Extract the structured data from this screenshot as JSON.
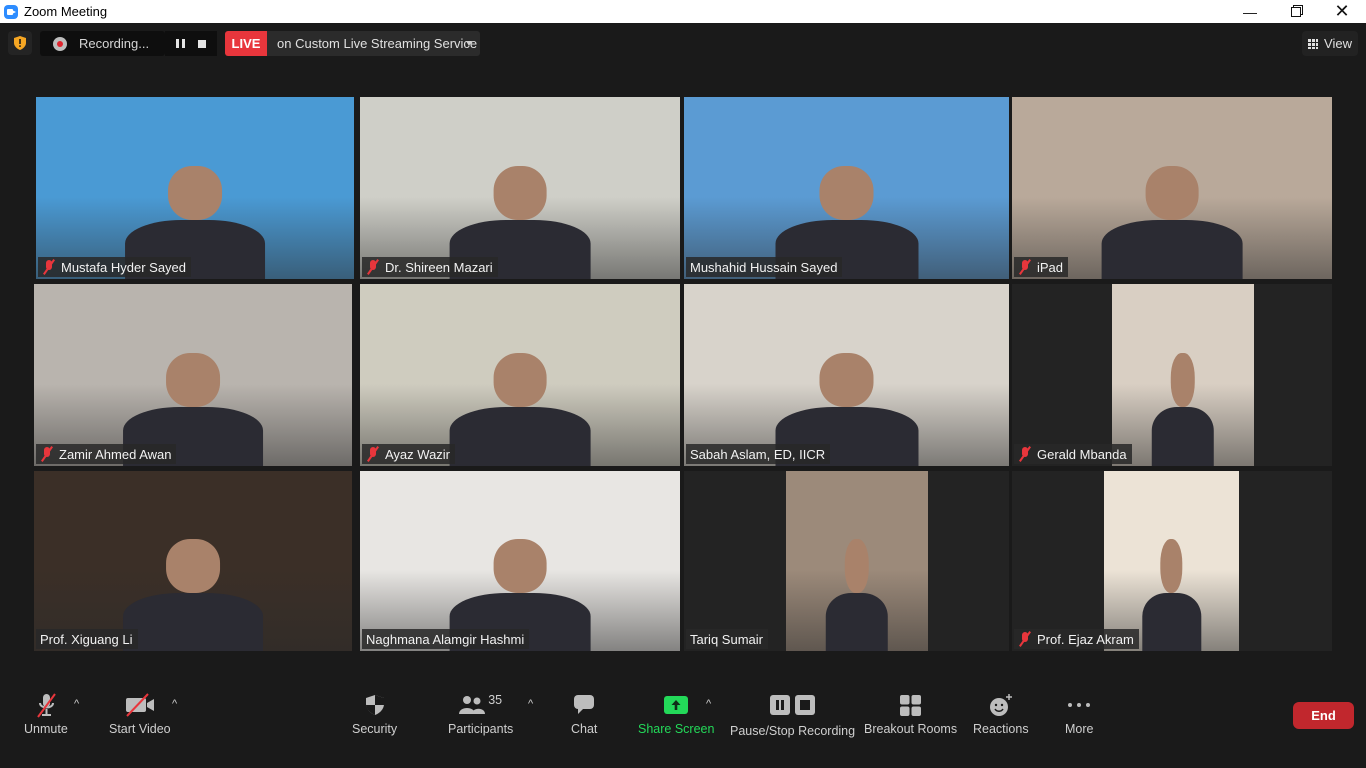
{
  "window": {
    "title": "Zoom Meeting",
    "controls": [
      "minimize",
      "restore",
      "close"
    ]
  },
  "topbar": {
    "security_icon": "shield-alert-icon",
    "recording_label": "Recording...",
    "live_badge": "LIVE",
    "live_service": "on Custom Live Streaming Service",
    "view_label": "View"
  },
  "participants_grid": [
    {
      "name": "Mustafa Hyder Sayed",
      "muted": true,
      "active": false,
      "bg": "#4a9ad4"
    },
    {
      "name": "Dr. Shireen Mazari",
      "muted": true,
      "active": false,
      "bg": "#cfcfc8"
    },
    {
      "name": "Mushahid Hussain Sayed",
      "muted": false,
      "active": false,
      "bg": "#5b9bd3"
    },
    {
      "name": "iPad",
      "muted": true,
      "active": false,
      "bg": "#b9a99a"
    },
    {
      "name": "Zamir Ahmed Awan",
      "muted": true,
      "active": false,
      "bg": "#b9b4ae"
    },
    {
      "name": "Ayaz Wazir",
      "muted": true,
      "active": false,
      "bg": "#cfccbf"
    },
    {
      "name": "Sabah Aslam, ED, IICR",
      "muted": false,
      "active": true,
      "bg": "#d8d3cb"
    },
    {
      "name": "Gerald Mbanda",
      "muted": true,
      "active": false,
      "bg": "#d9cfc3"
    },
    {
      "name": "Prof. Xiguang Li",
      "muted": false,
      "active": false,
      "bg": "#3b2f27"
    },
    {
      "name": "Naghmana Alamgir Hashmi",
      "muted": false,
      "active": false,
      "bg": "#e8e6e3"
    },
    {
      "name": "Tariq Sumair",
      "muted": false,
      "active": false,
      "bg": "#9c8a7a"
    },
    {
      "name": "Prof. Ejaz Akram",
      "muted": true,
      "active": false,
      "bg": "#ece3d6"
    }
  ],
  "toolbar": {
    "unmute": "Unmute",
    "start_video": "Start Video",
    "security": "Security",
    "participants": "Participants",
    "participants_count": "35",
    "chat": "Chat",
    "share_screen": "Share Screen",
    "pause_stop_recording": "Pause/Stop Recording",
    "breakout_rooms": "Breakout Rooms",
    "reactions": "Reactions",
    "more": "More",
    "end": "End"
  },
  "colors": {
    "live_red": "#e8363c",
    "share_green": "#23d959",
    "end_red": "#c1272d",
    "active_speaker": "#c6e25a"
  }
}
